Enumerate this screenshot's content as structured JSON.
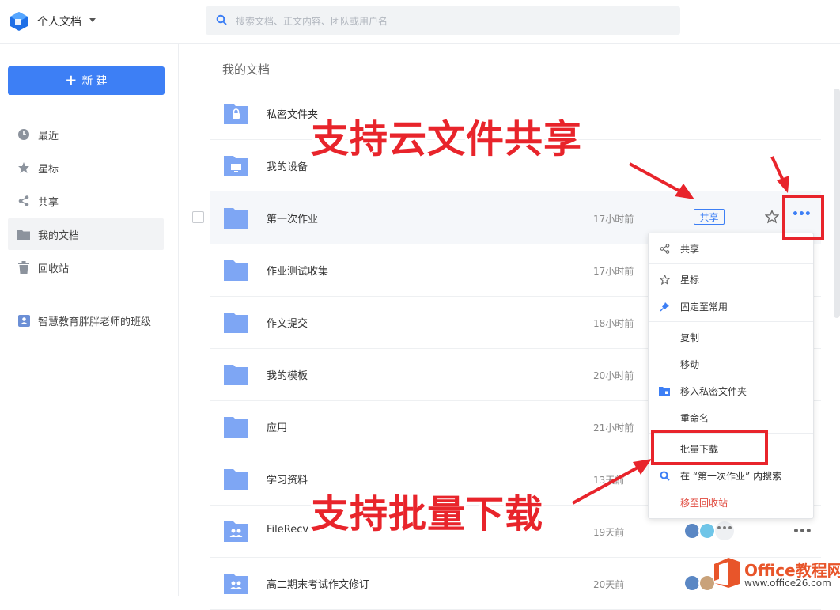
{
  "header": {
    "workspace_title": "个人文档",
    "search_placeholder": "搜索文档、正文内容、团队或用户名"
  },
  "sidebar": {
    "new_button_label": "新 建",
    "items": [
      {
        "label": "最近",
        "icon": "clock-icon"
      },
      {
        "label": "星标",
        "icon": "star-icon"
      },
      {
        "label": "共享",
        "icon": "share-icon"
      },
      {
        "label": "我的文档",
        "icon": "folder-icon",
        "active": true
      },
      {
        "label": "回收站",
        "icon": "trash-icon"
      },
      {
        "label": "智慧教育胖胖老师的班级",
        "icon": "team-icon"
      }
    ]
  },
  "main": {
    "breadcrumb": "我的文档",
    "rows": [
      {
        "name": "私密文件夹",
        "time": "",
        "icon": "lock-folder-icon"
      },
      {
        "name": "我的设备",
        "time": "",
        "icon": "device-folder-icon"
      },
      {
        "name": "第一次作业",
        "time": "17小时前",
        "badge": "共享",
        "icon": "folder-icon"
      },
      {
        "name": "作业测试收集",
        "time": "17小时前",
        "icon": "folder-icon"
      },
      {
        "name": "作文提交",
        "time": "18小时前",
        "icon": "folder-icon"
      },
      {
        "name": "我的模板",
        "time": "20小时前",
        "icon": "folder-icon"
      },
      {
        "name": "应用",
        "time": "21小时前",
        "icon": "folder-icon"
      },
      {
        "name": "学习资料",
        "time": "13天前",
        "icon": "folder-icon"
      },
      {
        "name": "FileRecv",
        "time": "19天前",
        "icon": "team-folder-icon"
      },
      {
        "name": "高二期末考试作文修订",
        "time": "20天前",
        "icon": "team-folder-icon"
      }
    ]
  },
  "context_menu": {
    "items": [
      {
        "label": "共享",
        "icon": "share-icon"
      },
      {
        "label": "星标",
        "icon": "star-icon"
      },
      {
        "label": "固定至常用",
        "icon": "pin-icon"
      },
      {
        "label": "复制",
        "icon": ""
      },
      {
        "label": "移动",
        "icon": ""
      },
      {
        "label": "移入私密文件夹",
        "icon": "lock-folder-icon"
      },
      {
        "label": "重命名",
        "icon": ""
      },
      {
        "label": "批量下载",
        "icon": ""
      },
      {
        "label": "在 “第一次作业” 内搜索",
        "icon": "search-icon"
      },
      {
        "label": "移至回收站",
        "icon": "",
        "danger": true
      }
    ]
  },
  "annotations": {
    "share_callout": "支持云文件共享",
    "download_callout": "支持批量下载"
  },
  "watermark": {
    "title": "Office教程网",
    "url": "www.office26.com"
  },
  "colors": {
    "accent": "#3d7ff5",
    "folder": "#7ea6f4",
    "danger": "#e0483d",
    "annotation_red": "#e8242b"
  }
}
